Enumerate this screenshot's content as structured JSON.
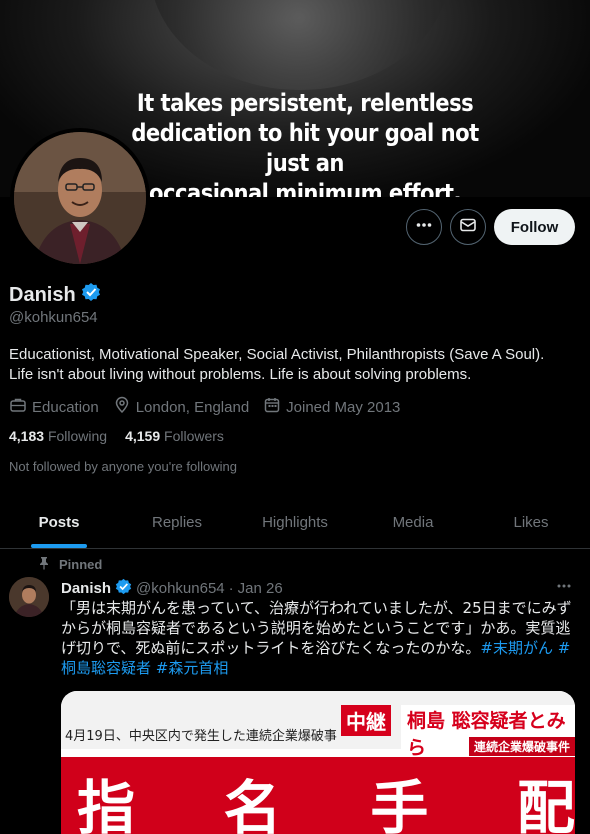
{
  "banner": {
    "quote_line1": "It takes persistent, relentless",
    "quote_line2": "dedication to hit your goal not just an",
    "quote_line3": "occasional minimum effort."
  },
  "profile": {
    "name": "Danish",
    "handle": "@kohkun654",
    "bio_line1": "Educationist, Motivational Speaker, Social Activist, Philanthropists  (Save A Soul).",
    "bio_line2": "Life isn't about living without problems. Life is about solving problems.",
    "category": "Education",
    "location": "London, England",
    "joined": "Joined May 2013",
    "following_count": "4,183",
    "following_label": "Following",
    "followers_count": "4,159",
    "followers_label": "Followers",
    "not_followed": "Not followed by anyone you're following",
    "verified_color": "#1d9bf0"
  },
  "actions": {
    "more_icon": "more-dots-icon",
    "message_icon": "envelope-icon",
    "follow_label": "Follow"
  },
  "tabs": [
    {
      "label": "Posts",
      "active": true
    },
    {
      "label": "Replies",
      "active": false
    },
    {
      "label": "Highlights",
      "active": false
    },
    {
      "label": "Media",
      "active": false
    },
    {
      "label": "Likes",
      "active": false
    }
  ],
  "post": {
    "pinned_label": "Pinned",
    "name": "Danish",
    "handle": "@kohkun654",
    "separator": "·",
    "date": "Jan 26",
    "text": "「男は末期がんを患っていて、治療が行われていましたが、25日までにみずからが桐島容疑者であるという説明を始めたということです」かあ。実質逃げ切りで、死ぬ前にスポットライトを浴びたくなったのかな。",
    "hashtag1": "#末期がん",
    "hashtag2": "#桐島聡容疑者",
    "hashtag3": "#森元首相",
    "media": {
      "subline": "4月19日、中央区内で発生した連続企業爆破事",
      "live_tag": "中継",
      "suspect_text": "桐島 聡容疑者とみら",
      "incident_tag": "連続企業爆破事件",
      "big1": "指",
      "big2": "名",
      "big3": "手",
      "big4": "配"
    }
  },
  "colors": {
    "accent": "#1d9bf0",
    "text": "#e7e9ea",
    "muted": "#71767b",
    "background": "#000000"
  }
}
